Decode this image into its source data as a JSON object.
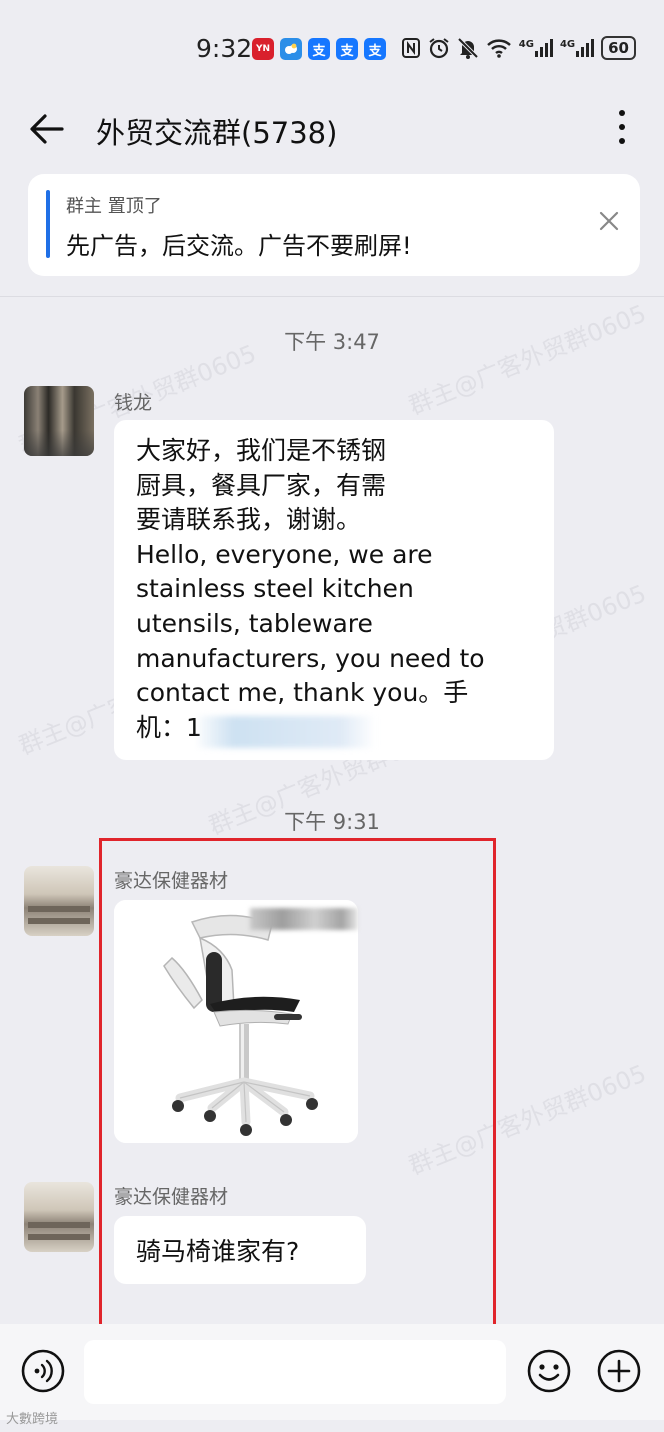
{
  "status_bar": {
    "time": "9:32",
    "battery": "60",
    "network_1": "4G",
    "network_2": "4G",
    "app_icons": [
      {
        "name": "yn-app-icon",
        "label": "YN",
        "color": "#d9202c"
      },
      {
        "name": "weather-icon",
        "label": "",
        "color": "#2b8ee8"
      },
      {
        "name": "alipay-icon",
        "label": "支",
        "color": "#1677ff"
      },
      {
        "name": "alipay-icon",
        "label": "支",
        "color": "#1677ff"
      },
      {
        "name": "alipay-icon",
        "label": "支",
        "color": "#1677ff"
      }
    ]
  },
  "header": {
    "title": "外贸交流群(5738)"
  },
  "pinned": {
    "meta": "群主 置顶了",
    "text": "先广告，后交流。广告不要刷屏!"
  },
  "messages": [
    {
      "timestamp": "下午 3:47"
    },
    {
      "sender": "钱龙",
      "text": "大家好，我们是不锈钢\n厨具，餐具厂家，有需\n要请联系我，谢谢。\nHello, everyone, we are\nstainless steel kitchen\nutensils, tableware\nmanufacturers, you need to\ncontact me, thank you。手\n机：1"
    },
    {
      "timestamp": "下午 9:31"
    },
    {
      "sender": "豪达保健器材",
      "image": "ergonomic-saddle-chair"
    },
    {
      "sender": "豪达保健器材",
      "text": "骑马椅谁家有?"
    }
  ],
  "watermark": {
    "lines": [
      "群主@广客外贸群0605",
      "群主@广客外贸群0605",
      "群主@广客外贸群0605",
      "群主@广客外贸群0605",
      "群主@广客外贸群0605",
      "群主@广客外贸群0605"
    ]
  },
  "footer_watermark": "大數跨境",
  "colors": {
    "accent": "#1f6fe6",
    "highlight_box": "#e0242b",
    "background": "#ededf2"
  }
}
